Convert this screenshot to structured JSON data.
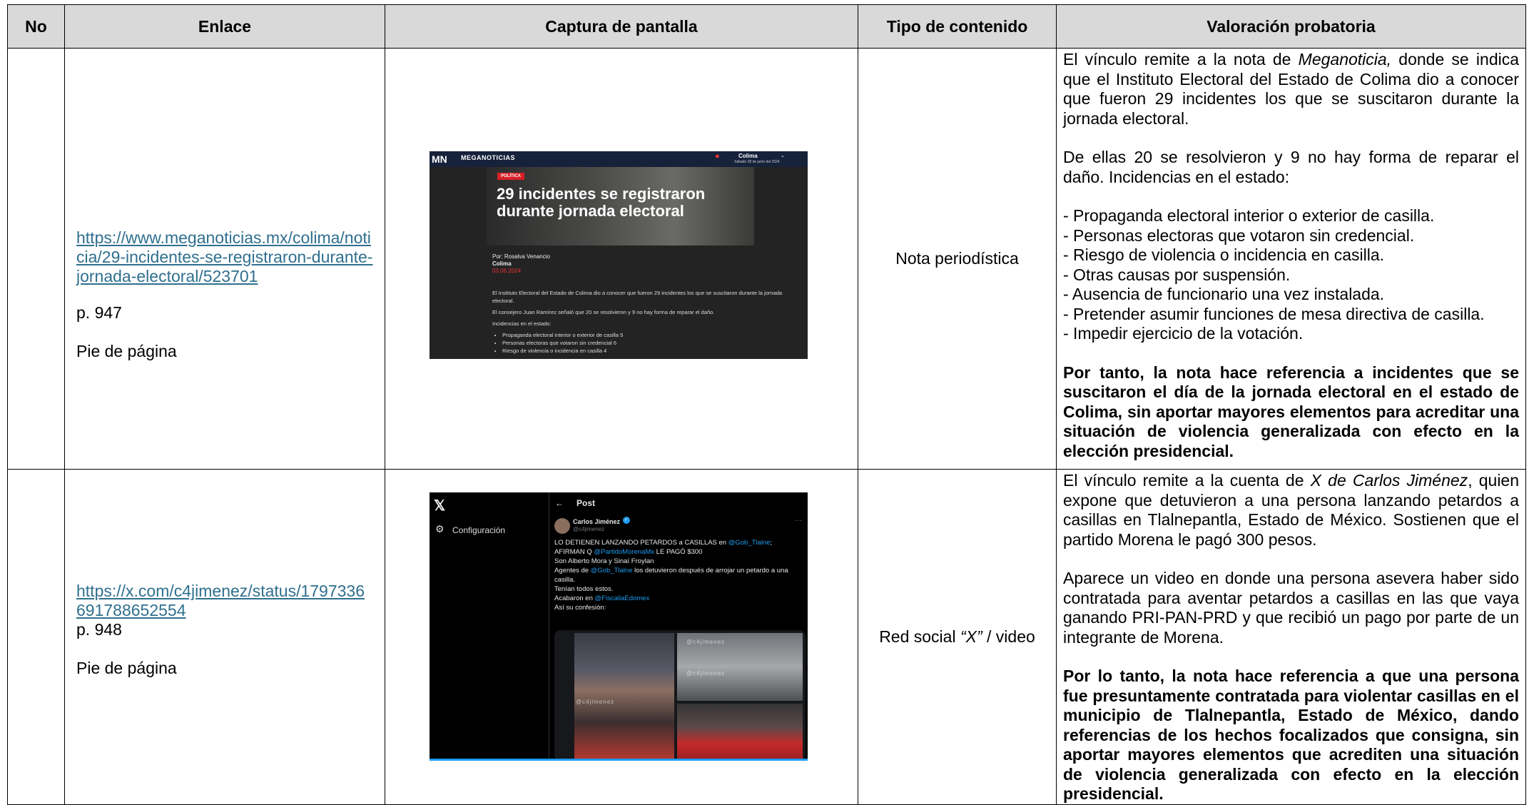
{
  "table": {
    "headers": [
      "No",
      "Enlace",
      "Captura de pantalla",
      "Tipo de contenido",
      "Valoración probatoria"
    ],
    "rows": [
      {
        "link": "https://www.meganoticias.mx/colima/noticia/29-incidentes-se-registraron-durante-jornada-electoral/523701",
        "page": "p. 947",
        "footnote": "Pie de página",
        "tipo": "Nota periodística",
        "val": {
          "p1_pre": "El vínculo remite a la nota de ",
          "p1_em": "Meganoticia,",
          "p1_post": " donde se indica que el Instituto Electoral del Estado de Colima dio a conocer que fueron 29 incidentes los que se suscitaron durante la jornada electoral.",
          "p2": "De ellas 20 se resolvieron y 9 no hay forma de reparar el daño. Incidencias en el estado:",
          "items": [
            "- Propaganda electoral interior o exterior de casilla.",
            "- Personas electoras que votaron sin credencial.",
            "- Riesgo de violencia o incidencia en casilla.",
            "- Otras causas por suspensión.",
            "- Ausencia de funcionario una vez instalada.",
            "- Pretender asumir funciones de mesa directiva de casilla.",
            "- Impedir ejercicio de la votación."
          ],
          "conclusion": "Por tanto, la nota hace referencia a incidentes que se suscitaron el día de la jornada electoral en el estado de Colima, sin aportar mayores elementos para acreditar una situación de violencia generalizada con efecto en la elección presidencial."
        },
        "screenshot": {
          "logo": "MN",
          "brand": "MEGANOTICIAS",
          "city": "Colima",
          "date": "Sábado 28 de junio del 2024",
          "tag": "POLÍTICA",
          "headline": "29 incidentes se registraron durante jornada electoral",
          "author": "Por: Rosalva Venancio",
          "place": "Colima",
          "pubdate": "03.06.2024",
          "p1": "El Instituto Electoral del Estado de Colima dio a conocer que fueron 29 incidentes los que se suscitaron durante la jornada electoral.",
          "p2": "El consejero Juan Ramírez señaló que 20 se resolvieron y 9 no hay forma de reparar el daño.",
          "p3": "Incidencias en el estado:",
          "bullets": [
            "Propaganda electoral interior o exterior de casilla 5",
            "Personas electoras que votaron sin credencial 6",
            "Riesgo de violencia o incidencia en casilla 4"
          ]
        }
      },
      {
        "link": "https://x.com/c4jimenez/status/1797336691788652554",
        "page": "p. 948",
        "footnote": "Pie de página",
        "tipo_pre": "Red social ",
        "tipo_em": "“X”",
        "tipo_post": " / video",
        "val": {
          "p1_pre": "El vínculo remite a la cuenta de ",
          "p1_em": "X de Carlos Jiménez",
          "p1_post": ", quien expone que detuvieron a una persona lanzando petardos a casillas en Tlalnepantla, Estado de México. Sostienen que el partido Morena le pagó 300 pesos.",
          "p2": "Aparece un video en donde una persona asevera haber sido contratada para aventar petardos a casillas en las que vaya ganando PRI-PAN-PRD y que recibió un pago por parte de un integrante de Morena.",
          "conclusion": "Por lo tanto, la nota hace referencia a que una persona fue presuntamente contratada para violentar casillas en el municipio de Tlalnepantla, Estado de México, dando referencias de los hechos focalizados que consigna, sin aportar mayores elementos que acrediten una situación de violencia generalizada con efecto en la elección presidencial."
        },
        "screenshot": {
          "config": "Configuración",
          "post_title": "Post",
          "user": "Carlos Jiménez",
          "handle": "@c4jimenez",
          "line1": "LO DETIENEN LANZANDO PETARDOS a CASILLAS en ",
          "mention1": "@Gob_Tlalne",
          "line1b": ";",
          "line2a": "AFIRMAN Q ",
          "mention2": "@PartidoMorenaMx",
          "line2b": " LE PAGÓ $300",
          "line3": "Son Alberto Mora y Sinaí Froylan",
          "line4a": "Agentes de ",
          "mention3": "@Gob_Tlalne",
          "line4b": " los detuvieron después de arrojar un petardo a una casilla.",
          "line5": "Tenían todos estos.",
          "line6a": "Acabaron en ",
          "mention4": "@FiscaliaEdomex",
          "line7": "Así su confesión:",
          "watermark": "@c4jimenez"
        }
      }
    ]
  }
}
